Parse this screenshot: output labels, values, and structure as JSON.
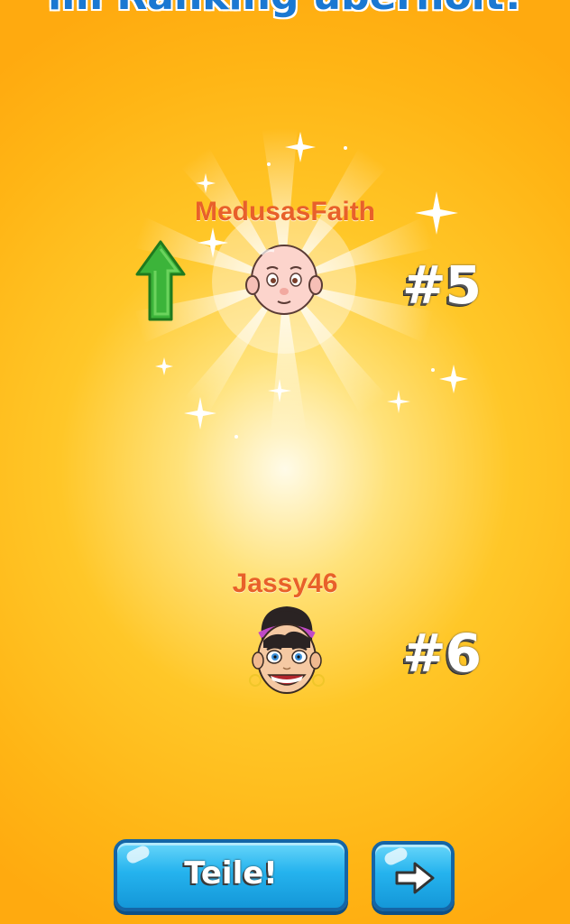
{
  "header": {
    "title": "im Ranking überholt!"
  },
  "players": [
    {
      "name": "MedusasFaith",
      "rank": "#5",
      "trend": "up"
    },
    {
      "name": "Jassy46",
      "rank": "#6"
    }
  ],
  "buttons": {
    "share_label": "Teile!",
    "next_icon": "arrow-right-icon"
  },
  "colors": {
    "background": "#ffb515",
    "name": "#e8602a",
    "title": "#1a78d2",
    "button": "#25b3ee",
    "arrow": "#3cb43a"
  }
}
